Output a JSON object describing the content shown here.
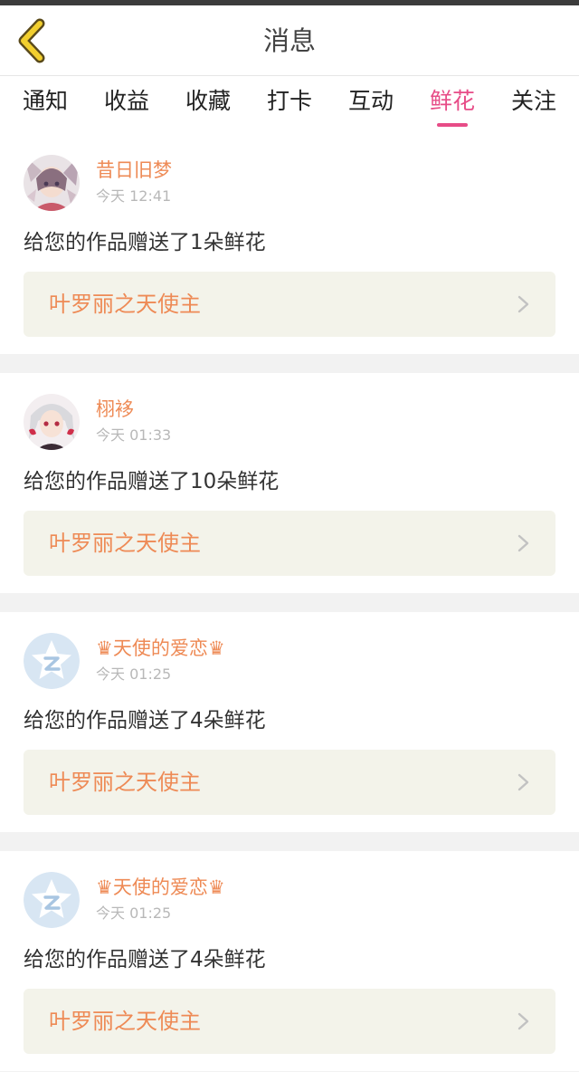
{
  "header": {
    "title": "消息"
  },
  "tabs": [
    {
      "label": "通知",
      "active": false
    },
    {
      "label": "收益",
      "active": false
    },
    {
      "label": "收藏",
      "active": false
    },
    {
      "label": "打卡",
      "active": false
    },
    {
      "label": "互动",
      "active": false
    },
    {
      "label": "鲜花",
      "active": true
    },
    {
      "label": "关注",
      "active": false
    }
  ],
  "messages": [
    {
      "user": "昔日旧梦",
      "time": "今天 12:41",
      "text": "给您的作品赠送了1朵鲜花",
      "work": "叶罗丽之天使主",
      "avatar_icon": "anime-girl-avatar"
    },
    {
      "user": "栩袳",
      "time": "今天 01:33",
      "text": "给您的作品赠送了10朵鲜花",
      "work": "叶罗丽之天使主",
      "avatar_icon": "anime-girl-avatar"
    },
    {
      "user": "♛天使的爱恋♛",
      "time": "今天 01:25",
      "text": "给您的作品赠送了4朵鲜花",
      "work": "叶罗丽之天使主",
      "avatar_icon": "default-star-avatar"
    },
    {
      "user": "♛天使的爱恋♛",
      "time": "今天 01:25",
      "text": "给您的作品赠送了4朵鲜花",
      "work": "叶罗丽之天使主",
      "avatar_icon": "default-star-avatar"
    }
  ],
  "colors": {
    "accent_pink": "#e74c87",
    "username_orange": "#ee8a55",
    "back_arrow_yellow": "#f2cf2e",
    "card_link_bg": "#f3f3ea"
  }
}
